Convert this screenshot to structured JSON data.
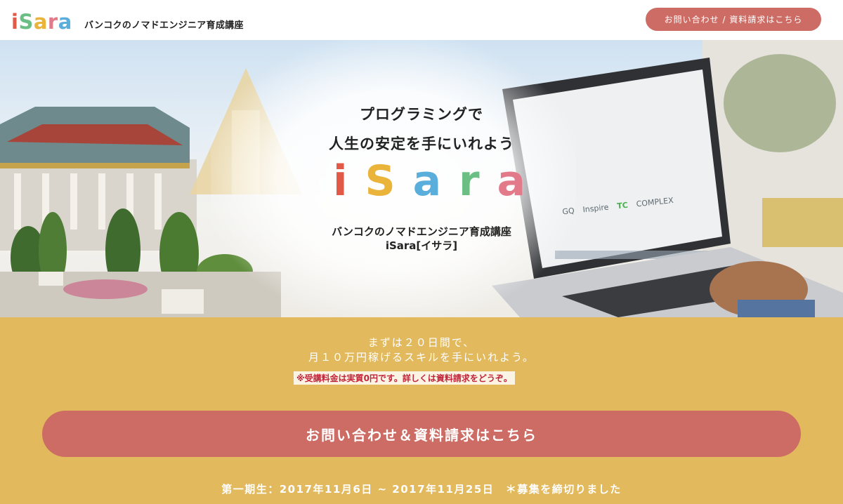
{
  "header": {
    "logo_letters": [
      {
        "char": "i",
        "color": "#e05a47"
      },
      {
        "char": "S",
        "color": "#6cbf84"
      },
      {
        "char": "a",
        "color": "#eab33a"
      },
      {
        "char": "r",
        "color": "#e27a8a"
      },
      {
        "char": "a",
        "color": "#5aaedb"
      }
    ],
    "tagline": "バンコクのノマドエンジニア育成講座",
    "cta_label": "お問い合わせ / 資料請求はこちら"
  },
  "hero": {
    "headline_line1": "プログラミングで",
    "headline_line2": "人生の安定を手にいれよう",
    "logo_letters": [
      {
        "char": "i",
        "color": "#e05a47"
      },
      {
        "char": "S",
        "color": "#eab33a"
      },
      {
        "char": "a",
        "color": "#5aaedb"
      },
      {
        "char": "r",
        "color": "#6cbf84"
      },
      {
        "char": "a",
        "color": "#e27a8a"
      }
    ],
    "sub_line1": "バンコクのノマドエンジニア育成講座",
    "sub_line2": "iSara[イサラ]",
    "laptop_screen_logos": [
      "GQ",
      "Inspire",
      "TC",
      "COMPLEX"
    ]
  },
  "band": {
    "line1": "まずは２０日間で、",
    "line2": "月１０万円稼げるスキルを手にいれよう。",
    "notice": "※受講料金は実質0円です。詳しくは資料請求をどうぞ。",
    "cta_label": "お問い合わせ＆資料請求はこちら",
    "period": "第一期生：2017年11月6日 ~ 2017年11月25日　＊募集を締切りました"
  },
  "colors": {
    "accent": "#cd6c64",
    "band": "#e2b95c",
    "notice_text": "#c2243a"
  }
}
